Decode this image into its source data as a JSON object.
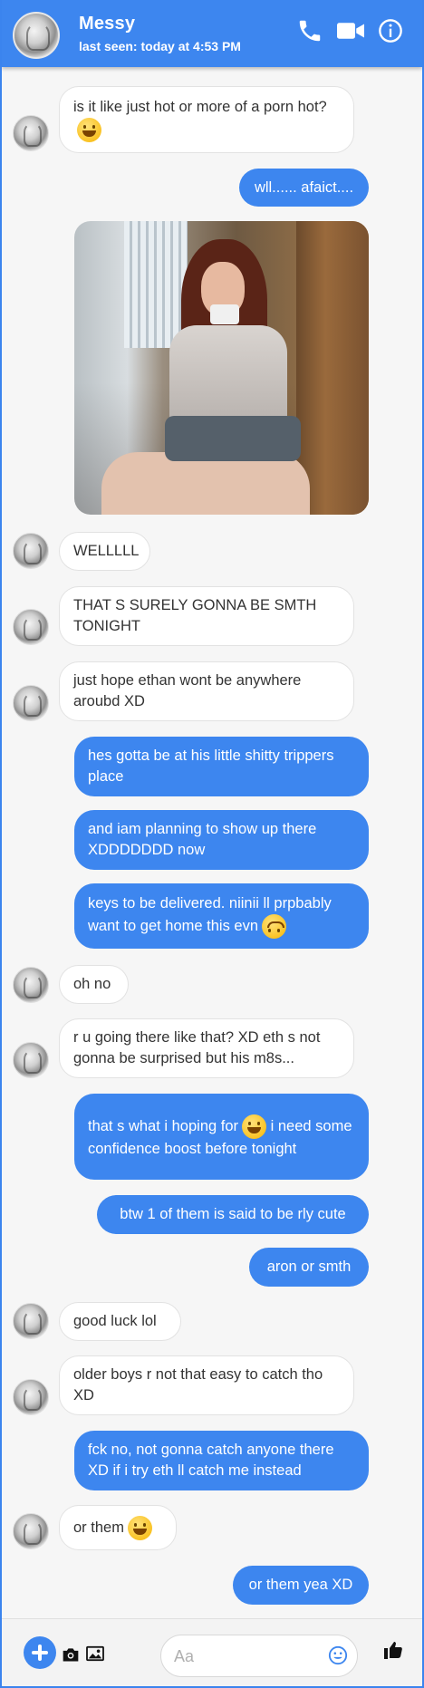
{
  "header": {
    "name": "Messy",
    "last_seen": "last seen: today at 4:53 PM",
    "icons": [
      "phone-icon",
      "video-camera-icon",
      "info-icon"
    ]
  },
  "messages": [
    {
      "dir": "in",
      "text": "is it like just hot or more of a porn hot?",
      "emoji": "sweat-smile"
    },
    {
      "dir": "out",
      "text": "wll...... afaict...."
    },
    {
      "dir": "out",
      "type": "photo",
      "image": "selfie-photo"
    },
    {
      "dir": "in",
      "text": "WELLLLL"
    },
    {
      "dir": "in",
      "text": "THAT S SURELY GONNA BE SMTH TONIGHT"
    },
    {
      "dir": "in",
      "text": "just hope ethan wont be anywhere aroubd XD"
    },
    {
      "dir": "out",
      "text": "hes gotta be at his little shitty trippers place"
    },
    {
      "dir": "out",
      "text": "and iam planning to show up there XDDDDDDD now"
    },
    {
      "dir": "out",
      "text": "keys to be delivered. niinii ll prpbably want to get home this evn",
      "emoji": "upside-down"
    },
    {
      "dir": "in",
      "text": "oh no"
    },
    {
      "dir": "in",
      "text": "r u going there like that? XD eth s not gonna be surprised but his m8s..."
    },
    {
      "dir": "out",
      "text_before": "that s what i hoping for",
      "text_after": "i need some confidence boost before tonight",
      "emoji": "grin"
    },
    {
      "dir": "out",
      "text": "btw 1 of them is said to be rly cute"
    },
    {
      "dir": "out",
      "text": "aron or smth"
    },
    {
      "dir": "in",
      "text": "good luck lol"
    },
    {
      "dir": "in",
      "text": "older boys r not that easy to catch tho XD"
    },
    {
      "dir": "out",
      "text": "fck no, not gonna catch anyone there XD if i try eth ll catch me instead"
    },
    {
      "dir": "in",
      "text": "or them",
      "emoji": "tears-of-joy"
    },
    {
      "dir": "out",
      "text": "or them yea XD"
    }
  ],
  "composer": {
    "placeholder": "Aa",
    "value": "",
    "icons": [
      "plus-icon",
      "camera-icon",
      "image-icon",
      "emoji-icon",
      "thumbs-up-icon"
    ]
  },
  "colors": {
    "accent": "#3d86ef",
    "incoming_bubble": "#ffffff",
    "background": "#f6f6f6"
  }
}
